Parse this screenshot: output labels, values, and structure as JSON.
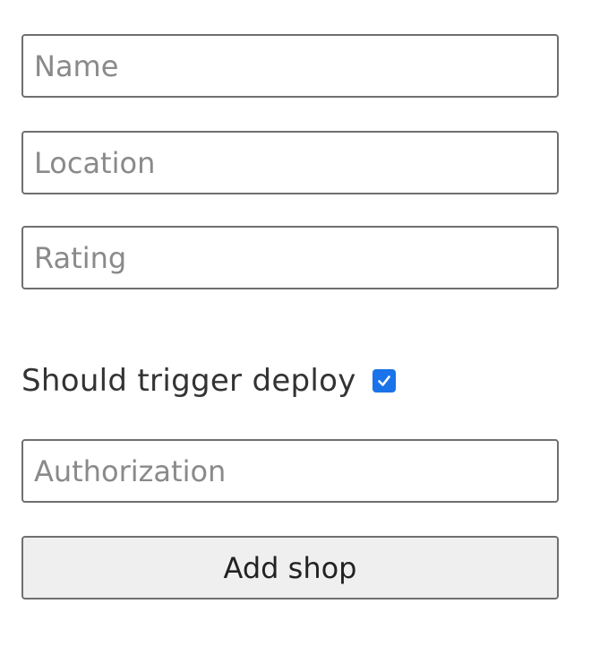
{
  "form": {
    "name": {
      "value": "",
      "placeholder": "Name"
    },
    "location": {
      "value": "",
      "placeholder": "Location"
    },
    "rating": {
      "value": "",
      "placeholder": "Rating"
    },
    "deploy": {
      "label": "Should trigger deploy",
      "checked": true
    },
    "authorization": {
      "value": "",
      "placeholder": "Authorization"
    },
    "submit_label": "Add shop"
  },
  "colors": {
    "checkbox_accent": "#1a73e8",
    "button_bg": "#efefef",
    "border": "#6f6f6f"
  },
  "icons": {
    "checkbox": "check-icon"
  }
}
